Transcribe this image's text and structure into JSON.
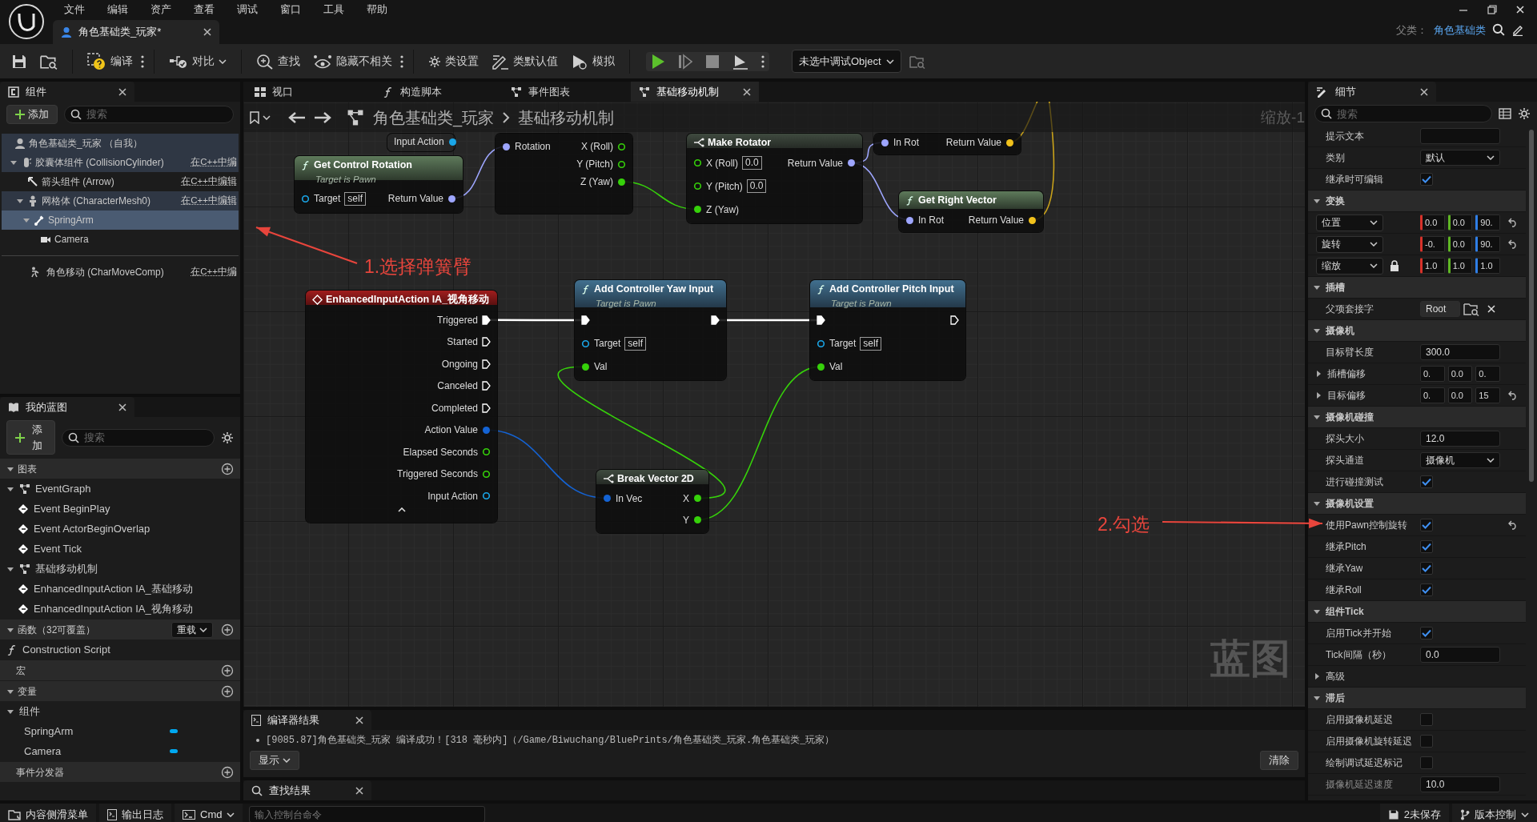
{
  "menu_bar": [
    "文件",
    "编辑",
    "资产",
    "查看",
    "调试",
    "窗口",
    "工具",
    "帮助"
  ],
  "document_tab": {
    "label": "角色基础类_玩家*"
  },
  "parent_class": {
    "label": "父类：",
    "value": "角色基础类"
  },
  "toolbar": {
    "compile": "编译",
    "diff": "对比",
    "find": "查找",
    "hide_unrelated": "隐藏不相关",
    "class_settings": "类设置",
    "class_defaults": "类默认值",
    "simulate": "模拟",
    "debug_object": "未选中调试Object"
  },
  "components_panel": {
    "title": "组件",
    "add_button": "添加",
    "search_placeholder": "搜索",
    "tree": [
      {
        "label": "角色基础类_玩家 （自我）",
        "selected": false,
        "children": [
          {
            "label": "胶囊体组件 (CollisionCylinder)",
            "edit_link": "在C++中编",
            "selected": false,
            "expanded": true,
            "children": [
              {
                "label": "箭头组件 (Arrow)",
                "edit_link": "在C++中编辑",
                "selected": false
              },
              {
                "label": "网格体 (CharacterMesh0)",
                "edit_link": "在C++中编辑",
                "selected": false,
                "expanded": true,
                "children": [
                  {
                    "label": "SpringArm",
                    "selected": true,
                    "expanded": true,
                    "children": [
                      {
                        "label": "Camera",
                        "selected": false
                      }
                    ]
                  }
                ]
              }
            ]
          }
        ]
      }
    ],
    "other_components": [
      {
        "label": "角色移动 (CharMoveComp)",
        "edit_link": "在C++中编",
        "selected": false
      }
    ]
  },
  "my_blueprint": {
    "title": "我的蓝图",
    "add_button": "添加",
    "search_placeholder": "搜索",
    "sections": [
      {
        "label": "图表",
        "expanded": true,
        "items": [
          {
            "kind": "graph",
            "label": "EventGraph",
            "expanded": true,
            "children": [
              {
                "kind": "event",
                "label": "Event BeginPlay"
              },
              {
                "kind": "event",
                "label": "Event ActorBeginOverlap"
              },
              {
                "kind": "event",
                "label": "Event Tick"
              }
            ]
          },
          {
            "kind": "graph",
            "label": "基础移动机制",
            "expanded": true,
            "children": [
              {
                "kind": "event",
                "label": "EnhancedInputAction IA_基础移动"
              },
              {
                "kind": "event",
                "label": "EnhancedInputAction IA_视角移动"
              }
            ]
          }
        ]
      },
      {
        "label": "函数（32可覆盖）",
        "expanded": true,
        "override_button": "重载",
        "items": [
          {
            "kind": "function",
            "label": "Construction Script"
          }
        ]
      },
      {
        "label": "宏"
      },
      {
        "label": "变量",
        "expanded": true,
        "items": [
          {
            "kind": "category",
            "label": "组件",
            "expanded": true,
            "children": [
              {
                "kind": "variable",
                "label": "SpringArm"
              },
              {
                "kind": "variable",
                "label": "Camera"
              }
            ]
          }
        ]
      },
      {
        "label": "事件分发器"
      }
    ]
  },
  "graph_tabs": [
    {
      "label": "视口",
      "selected": false
    },
    {
      "label": "构造脚本",
      "selected": false
    },
    {
      "label": "事件图表",
      "selected": false
    },
    {
      "label": "基础移动机制",
      "selected": true
    }
  ],
  "breadcrumb": [
    "角色基础类_玩家",
    "基础移动机制"
  ],
  "zoom_label": "缩放-1",
  "graph_label": "蓝图",
  "nodes": [
    {
      "kind": "fragment",
      "outputs": [
        {
          "kind": "data",
          "label": "Input Action",
          "color": "#1aa6e8",
          "connected": true
        }
      ]
    },
    {
      "kind": "fragment",
      "inputs": [
        {
          "kind": "data",
          "label": "Rotation",
          "color": "#9ea6ff",
          "connected": true
        }
      ],
      "outputs": [
        {
          "kind": "data",
          "label": "X (Roll)",
          "color": "#36d10a",
          "connected": false
        },
        {
          "kind": "data",
          "label": "Y (Pitch)",
          "color": "#36d10a",
          "connected": false
        },
        {
          "kind": "data",
          "label": "Z (Yaw)",
          "color": "#36d10a",
          "connected": true
        }
      ]
    },
    {
      "kind": "struct",
      "title": "Make Rotator",
      "inputs": [
        {
          "kind": "data",
          "label": "X (Roll)",
          "color": "#36d10a",
          "connected": false,
          "value": "0.0"
        },
        {
          "kind": "data",
          "label": "Y (Pitch)",
          "color": "#36d10a",
          "connected": false,
          "value": "0.0"
        },
        {
          "kind": "data",
          "label": "Z (Yaw)",
          "color": "#36d10a",
          "connected": true
        }
      ],
      "outputs": [
        {
          "kind": "data",
          "label": "Return Value",
          "color": "#9ea6ff",
          "connected": true
        }
      ]
    },
    {
      "kind": "fragment",
      "inputs": [
        {
          "kind": "data",
          "label": "In Rot",
          "color": "#9ea6ff",
          "connected": true
        }
      ],
      "outputs": [
        {
          "kind": "data",
          "label": "Return Value",
          "color": "#f2c21c",
          "connected": true
        }
      ]
    },
    {
      "kind": "pure",
      "title": "Get Control Rotation",
      "subtitle": "Target is Pawn",
      "inputs": [
        {
          "kind": "data",
          "label": "Target",
          "color": "#1aa6e8",
          "connected": false,
          "value": "self"
        }
      ],
      "outputs": [
        {
          "kind": "data",
          "label": "Return Value",
          "color": "#9ea6ff",
          "connected": true
        }
      ]
    },
    {
      "kind": "pure",
      "title": "Get Right Vector",
      "inputs": [
        {
          "kind": "data",
          "label": "In Rot",
          "color": "#9ea6ff",
          "connected": true
        }
      ],
      "outputs": [
        {
          "kind": "data",
          "label": "Return Value",
          "color": "#f2c21c",
          "connected": true
        }
      ]
    },
    {
      "kind": "event",
      "title": "EnhancedInputAction IA_视角移动",
      "outputs": [
        {
          "kind": "exec",
          "label": "Triggered",
          "connected": true
        },
        {
          "kind": "exec",
          "label": "Started",
          "connected": false
        },
        {
          "kind": "exec",
          "label": "Ongoing",
          "connected": false
        },
        {
          "kind": "exec",
          "label": "Canceled",
          "connected": false
        },
        {
          "kind": "exec",
          "label": "Completed",
          "connected": false
        },
        {
          "kind": "data",
          "label": "Action Value",
          "color": "#1463d4",
          "connected": true
        },
        {
          "kind": "data",
          "label": "Elapsed Seconds",
          "color": "#36d10a",
          "connected": false
        },
        {
          "kind": "data",
          "label": "Triggered Seconds",
          "color": "#36d10a",
          "connected": false
        },
        {
          "kind": "data",
          "label": "Input Action",
          "color": "#1aa6e8",
          "connected": false
        }
      ]
    },
    {
      "kind": "function",
      "title": "Add Controller Yaw Input",
      "subtitle": "Target is Pawn",
      "inputs": [
        {
          "kind": "exec",
          "connected": true
        },
        {
          "kind": "data",
          "label": "Target",
          "color": "#1aa6e8",
          "connected": false,
          "value": "self"
        },
        {
          "kind": "data",
          "label": "Val",
          "color": "#36d10a",
          "connected": true
        }
      ],
      "outputs": [
        {
          "kind": "exec",
          "connected": true
        }
      ]
    },
    {
      "kind": "function",
      "title": "Add Controller Pitch Input",
      "subtitle": "Target is Pawn",
      "inputs": [
        {
          "kind": "exec",
          "connected": true
        },
        {
          "kind": "data",
          "label": "Target",
          "color": "#1aa6e8",
          "connected": false,
          "value": "self"
        },
        {
          "kind": "data",
          "label": "Val",
          "color": "#36d10a",
          "connected": true
        }
      ],
      "outputs": [
        {
          "kind": "exec",
          "connected": false
        }
      ]
    },
    {
      "kind": "struct",
      "title": "Break Vector 2D",
      "inputs": [
        {
          "kind": "data",
          "label": "In Vec",
          "color": "#1463d4",
          "connected": true
        }
      ],
      "outputs": [
        {
          "kind": "data",
          "label": "X",
          "color": "#36d10a",
          "connected": true
        },
        {
          "kind": "data",
          "label": "Y",
          "color": "#36d10a",
          "connected": true
        }
      ]
    }
  ],
  "annotations": [
    {
      "text": "1.选择弹簧臂"
    },
    {
      "text": "2.勾选"
    }
  ],
  "details": {
    "title": "细节",
    "search_placeholder": "搜索",
    "rows": [
      {
        "kind": "text",
        "label": "提示文本"
      },
      {
        "kind": "dropdown",
        "label": "类别",
        "value": "默认"
      },
      {
        "kind": "check",
        "label": "继承时可编辑",
        "checked": true,
        "reset": false
      },
      {
        "kind": "section",
        "label": "变换",
        "expanded": true
      },
      {
        "kind": "transform",
        "label": "位置",
        "values": [
          "0.0",
          "0.0",
          "90."
        ],
        "reset": true,
        "locked": false
      },
      {
        "kind": "transform",
        "label": "旋转",
        "values": [
          "-0.",
          "0.0",
          "90."
        ],
        "reset": true,
        "locked": false
      },
      {
        "kind": "transform",
        "label": "缩放",
        "values": [
          "1.0",
          "1.0",
          "1.0"
        ],
        "reset": false,
        "locked": true
      },
      {
        "kind": "section",
        "label": "插槽",
        "expanded": true
      },
      {
        "kind": "socket",
        "label": "父项套接字",
        "value": "Root"
      },
      {
        "kind": "section",
        "label": "摄像机",
        "expanded": true
      },
      {
        "kind": "text",
        "label": "目标臂长度",
        "value": "300.0"
      },
      {
        "kind": "vector",
        "label": "插槽偏移",
        "expanded": false,
        "values": [
          "0.",
          "0.0",
          "0."
        ],
        "reset": false
      },
      {
        "kind": "vector",
        "label": "目标偏移",
        "expanded": false,
        "values": [
          "0.",
          "0.0",
          "15"
        ],
        "reset": true
      },
      {
        "kind": "section",
        "label": "摄像机碰撞",
        "expanded": true
      },
      {
        "kind": "text",
        "label": "探头大小",
        "value": "12.0"
      },
      {
        "kind": "dropdown",
        "label": "探头通道",
        "value": "摄像机"
      },
      {
        "kind": "check",
        "label": "进行碰撞测试",
        "checked": true,
        "reset": false
      },
      {
        "kind": "section",
        "label": "摄像机设置",
        "expanded": true
      },
      {
        "kind": "check",
        "label": "使用Pawn控制旋转",
        "checked": true,
        "reset": true
      },
      {
        "kind": "check",
        "label": "继承Pitch",
        "checked": true,
        "reset": false
      },
      {
        "kind": "check",
        "label": "继承Yaw",
        "checked": true,
        "reset": false
      },
      {
        "kind": "check",
        "label": "继承Roll",
        "checked": true,
        "reset": false
      },
      {
        "kind": "section",
        "label": "组件Tick",
        "expanded": true
      },
      {
        "kind": "check",
        "label": "启用Tick并开始",
        "checked": true,
        "reset": false
      },
      {
        "kind": "text",
        "label": "Tick间隔（秒）",
        "value": "0.0"
      },
      {
        "kind": "group",
        "label": "高级",
        "expanded": false
      },
      {
        "kind": "section",
        "label": "滞后",
        "expanded": true
      },
      {
        "kind": "check",
        "label": "启用摄像机延迟",
        "checked": false,
        "reset": false
      },
      {
        "kind": "check",
        "label": "启用摄像机旋转延迟",
        "checked": false,
        "reset": false
      },
      {
        "kind": "check",
        "label": "绘制调试延迟标记",
        "checked": false,
        "reset": false
      },
      {
        "kind": "text",
        "label": "摄像机延迟速度",
        "value": "10.0"
      }
    ]
  },
  "compiler_results": {
    "title": "编译器结果",
    "messages": [
      "[9085.87]角色基础类_玩家 编译成功！[318 毫秒内]（/Game/Biwuchang/BluePrints/角色基础类_玩家.角色基础类_玩家）"
    ],
    "show_button": "显示",
    "clear_button": "清除"
  },
  "find_results": {
    "title": "查找结果"
  },
  "status_bar": {
    "content_drawer": "内容侧滑菜单",
    "output_log": "输出日志",
    "cmd": "Cmd",
    "console_placeholder": "输入控制台命令",
    "unsaved": "2未保存",
    "source_control": "版本控制"
  }
}
